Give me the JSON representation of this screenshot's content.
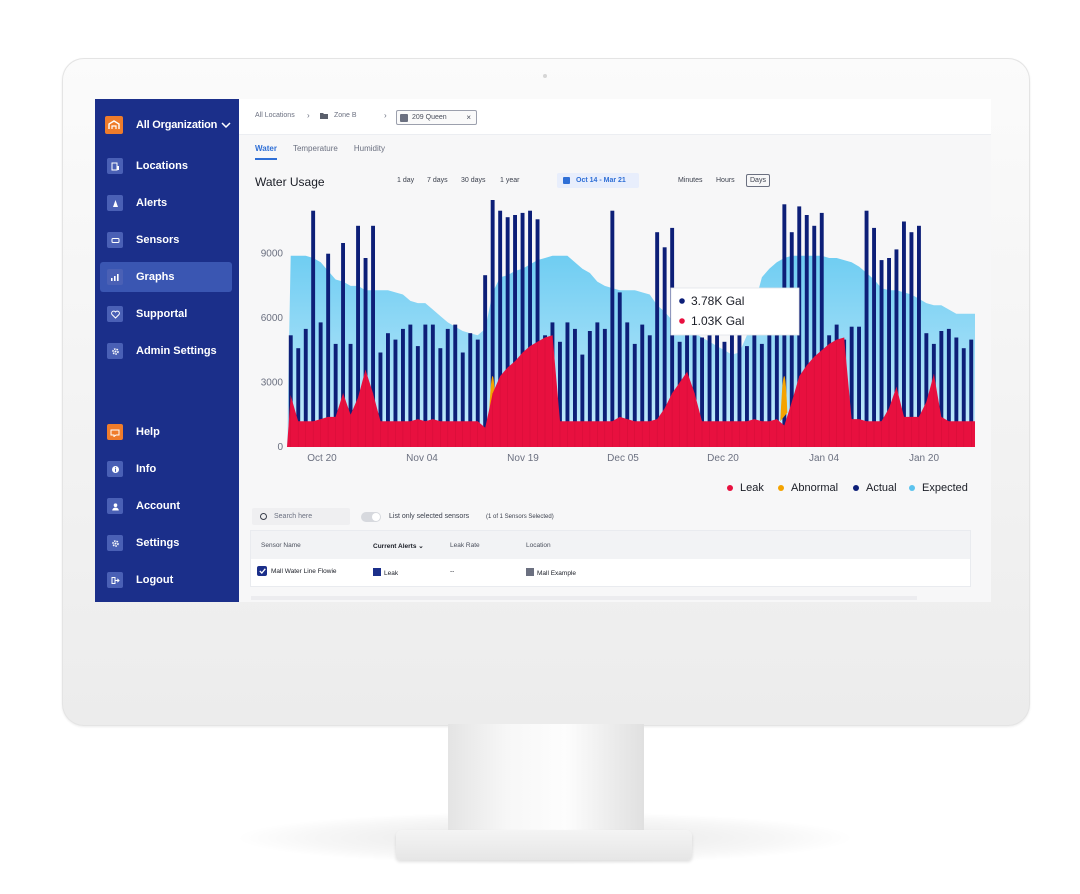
{
  "sidebar": {
    "org_name": "All Organization",
    "items": [
      {
        "label": "Locations",
        "icon": "building-icon"
      },
      {
        "label": "Alerts",
        "icon": "alert-icon"
      },
      {
        "label": "Sensors",
        "icon": "sensor-icon"
      },
      {
        "label": "Graphs",
        "icon": "graph-icon",
        "active": true
      },
      {
        "label": "Supportal",
        "icon": "heart-icon"
      },
      {
        "label": "Admin Settings",
        "icon": "gear-icon"
      },
      {
        "label": "Help",
        "icon": "help-icon"
      },
      {
        "label": "Info",
        "icon": "info-icon"
      },
      {
        "label": "Account",
        "icon": "account-icon"
      },
      {
        "label": "Settings",
        "icon": "gear-icon"
      },
      {
        "label": "Logout",
        "icon": "logout-icon"
      }
    ]
  },
  "breadcrumb": {
    "root": "All Locations",
    "zone": "Zone B",
    "location": "209 Queen"
  },
  "tabs": [
    "Water",
    "Temperature",
    "Humidity"
  ],
  "chart_header": {
    "title": "Water Usage",
    "ranges": [
      "1 day",
      "7 days",
      "30 days",
      "1 year"
    ],
    "date_range": "Oct 14 - Mar 21",
    "units": [
      "Minutes",
      "Hours",
      "Days"
    ],
    "active_unit": "Days"
  },
  "tooltip": {
    "actual": "3.78K Gal",
    "leak": "1.03K Gal"
  },
  "legend": [
    "Leak",
    "Abnormal",
    "Actual",
    "Expected"
  ],
  "colors": {
    "leak": "#e8103f",
    "abnormal": "#f4a300",
    "actual": "#0d1f78",
    "expected": "#5cc3ee",
    "sidebar": "#1b2f8a",
    "accent": "#2f6fd6"
  },
  "chart_data": {
    "type": "bar",
    "y_ticks": [
      0,
      3000,
      6000,
      9000
    ],
    "ylim": [
      0,
      11500
    ],
    "x_tick_labels": [
      "Oct 20",
      "Nov 04",
      "Nov 19",
      "Dec 05",
      "Dec 20",
      "Jan 04",
      "Jan 20"
    ],
    "series": [
      {
        "name": "Actual",
        "values": [
          5200,
          4600,
          5500,
          11000,
          5800,
          9000,
          4800,
          9500,
          4800,
          10300,
          8800,
          10300,
          4400,
          5300,
          5000,
          5500,
          5700,
          4700,
          5700,
          5700,
          4600,
          5500,
          5700,
          4400,
          5300,
          5000,
          8000,
          11500,
          11000,
          10700,
          10800,
          10900,
          11000,
          10600,
          5200,
          5800,
          4900,
          5800,
          5500,
          4300,
          5400,
          5800,
          5500,
          11000,
          7200,
          5800,
          4800,
          5700,
          5200,
          10000,
          9300,
          10200,
          4900,
          5600,
          5800,
          5100,
          5700,
          5700,
          4900,
          5500,
          5700,
          4700,
          5300,
          4800,
          5800,
          5900,
          11300,
          10000,
          11200,
          10800,
          10300,
          10900,
          5200,
          5700,
          5000,
          5600,
          5600,
          11000,
          10200,
          8700,
          8800,
          9200,
          10500,
          10000,
          10300,
          5300,
          4800,
          5400,
          5500,
          5100,
          4600,
          5000
        ]
      },
      {
        "name": "Expected",
        "values": [
          8900,
          8900,
          8900,
          8800,
          8600,
          8200,
          7800,
          7700,
          7500,
          7500,
          7300,
          7300,
          7300,
          7300,
          7200,
          7100,
          6800,
          6700,
          6700,
          6400,
          6100,
          5800,
          5600,
          5400,
          5300,
          5200,
          5500,
          7200,
          7900,
          8000,
          8200,
          8300,
          8500,
          8700,
          8800,
          8900,
          8900,
          8900,
          8600,
          8300,
          8100,
          7700,
          7500,
          7400,
          7300,
          7300,
          7300,
          7200,
          7100,
          6600,
          6300,
          5900,
          5600,
          5500,
          5300,
          5100,
          4900,
          4700,
          4500,
          4300,
          4400,
          5200,
          6600,
          7900,
          8300,
          8600,
          8800,
          8900,
          8900,
          8900,
          8900,
          8900,
          8800,
          8800,
          8700,
          8600,
          8400,
          8100,
          7800,
          7400,
          7300,
          7300,
          7200,
          7100,
          6900,
          6700,
          6600,
          6600,
          6400,
          6200,
          6200,
          6200
        ]
      },
      {
        "name": "Leak",
        "values": [
          2400,
          1200,
          1200,
          1200,
          1300,
          1400,
          1400,
          2500,
          1500,
          2300,
          3600,
          2500,
          1200,
          1200,
          1200,
          1200,
          1200,
          1300,
          1200,
          1300,
          1200,
          1200,
          1200,
          1200,
          1200,
          1200,
          900,
          2500,
          3300,
          3700,
          4000,
          4400,
          4700,
          4900,
          5100,
          5200,
          1200,
          1200,
          1200,
          1200,
          1200,
          1200,
          1200,
          1200,
          1400,
          1300,
          1200,
          1200,
          1200,
          1300,
          1800,
          2500,
          3000,
          3500,
          2500,
          1200,
          1200,
          1200,
          1200,
          1200,
          1200,
          1200,
          1300,
          1200,
          1200,
          1300,
          1000,
          2100,
          3300,
          3800,
          4200,
          4500,
          4800,
          5000,
          5100,
          1300,
          1300,
          1200,
          1200,
          1200,
          1800,
          2800,
          1400,
          1400,
          1400,
          2100,
          3400,
          1400,
          1200,
          1200,
          1200,
          1200
        ]
      },
      {
        "name": "Abnormal",
        "values": [
          0,
          0,
          0,
          0,
          0,
          0,
          0,
          0,
          0,
          0,
          0,
          0,
          0,
          0,
          0,
          0,
          0,
          0,
          0,
          0,
          0,
          0,
          0,
          0,
          0,
          0,
          0,
          5200,
          0,
          0,
          0,
          0,
          0,
          0,
          0,
          0,
          0,
          0,
          0,
          0,
          0,
          0,
          0,
          0,
          0,
          0,
          0,
          0,
          0,
          0,
          0,
          0,
          0,
          0,
          0,
          0,
          0,
          0,
          0,
          0,
          0,
          0,
          0,
          0,
          0,
          0,
          5200,
          0,
          0,
          0,
          0,
          0,
          0,
          0,
          0,
          0,
          0,
          0,
          0,
          0,
          0,
          0,
          0,
          0,
          0,
          0,
          0,
          0,
          0,
          0,
          0,
          0
        ]
      }
    ]
  },
  "table_controls": {
    "search_placeholder": "Search here",
    "toggle_label": "List only selected sensors",
    "toggle_sub": "(1 of 1 Sensors Selected)"
  },
  "table": {
    "headers": [
      "Sensor Name",
      "Current Alerts",
      "Leak Rate",
      "Location"
    ],
    "rows": [
      {
        "sensor": "Mall Water Line Flowie",
        "alert": "Leak",
        "leak_rate": "--",
        "location": "Mall Example",
        "checked": true
      }
    ]
  }
}
